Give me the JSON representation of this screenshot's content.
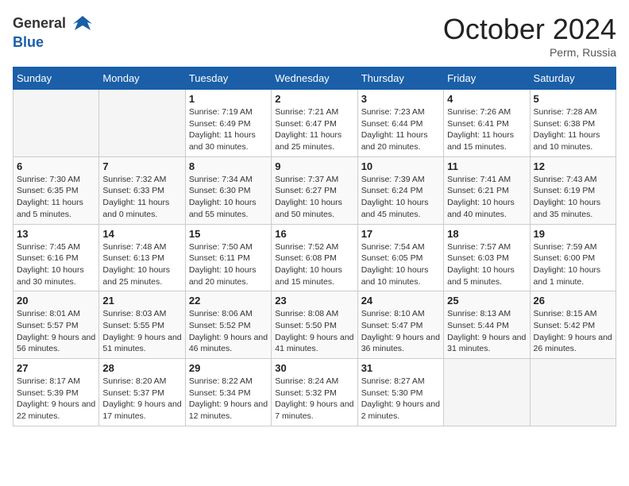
{
  "header": {
    "logo_general": "General",
    "logo_blue": "Blue",
    "month_title": "October 2024",
    "location": "Perm, Russia"
  },
  "weekdays": [
    "Sunday",
    "Monday",
    "Tuesday",
    "Wednesday",
    "Thursday",
    "Friday",
    "Saturday"
  ],
  "weeks": [
    [
      {
        "day": "",
        "info": ""
      },
      {
        "day": "",
        "info": ""
      },
      {
        "day": "1",
        "info": "Sunrise: 7:19 AM\nSunset: 6:49 PM\nDaylight: 11 hours and 30 minutes."
      },
      {
        "day": "2",
        "info": "Sunrise: 7:21 AM\nSunset: 6:47 PM\nDaylight: 11 hours and 25 minutes."
      },
      {
        "day": "3",
        "info": "Sunrise: 7:23 AM\nSunset: 6:44 PM\nDaylight: 11 hours and 20 minutes."
      },
      {
        "day": "4",
        "info": "Sunrise: 7:26 AM\nSunset: 6:41 PM\nDaylight: 11 hours and 15 minutes."
      },
      {
        "day": "5",
        "info": "Sunrise: 7:28 AM\nSunset: 6:38 PM\nDaylight: 11 hours and 10 minutes."
      }
    ],
    [
      {
        "day": "6",
        "info": "Sunrise: 7:30 AM\nSunset: 6:35 PM\nDaylight: 11 hours and 5 minutes."
      },
      {
        "day": "7",
        "info": "Sunrise: 7:32 AM\nSunset: 6:33 PM\nDaylight: 11 hours and 0 minutes."
      },
      {
        "day": "8",
        "info": "Sunrise: 7:34 AM\nSunset: 6:30 PM\nDaylight: 10 hours and 55 minutes."
      },
      {
        "day": "9",
        "info": "Sunrise: 7:37 AM\nSunset: 6:27 PM\nDaylight: 10 hours and 50 minutes."
      },
      {
        "day": "10",
        "info": "Sunrise: 7:39 AM\nSunset: 6:24 PM\nDaylight: 10 hours and 45 minutes."
      },
      {
        "day": "11",
        "info": "Sunrise: 7:41 AM\nSunset: 6:21 PM\nDaylight: 10 hours and 40 minutes."
      },
      {
        "day": "12",
        "info": "Sunrise: 7:43 AM\nSunset: 6:19 PM\nDaylight: 10 hours and 35 minutes."
      }
    ],
    [
      {
        "day": "13",
        "info": "Sunrise: 7:45 AM\nSunset: 6:16 PM\nDaylight: 10 hours and 30 minutes."
      },
      {
        "day": "14",
        "info": "Sunrise: 7:48 AM\nSunset: 6:13 PM\nDaylight: 10 hours and 25 minutes."
      },
      {
        "day": "15",
        "info": "Sunrise: 7:50 AM\nSunset: 6:11 PM\nDaylight: 10 hours and 20 minutes."
      },
      {
        "day": "16",
        "info": "Sunrise: 7:52 AM\nSunset: 6:08 PM\nDaylight: 10 hours and 15 minutes."
      },
      {
        "day": "17",
        "info": "Sunrise: 7:54 AM\nSunset: 6:05 PM\nDaylight: 10 hours and 10 minutes."
      },
      {
        "day": "18",
        "info": "Sunrise: 7:57 AM\nSunset: 6:03 PM\nDaylight: 10 hours and 5 minutes."
      },
      {
        "day": "19",
        "info": "Sunrise: 7:59 AM\nSunset: 6:00 PM\nDaylight: 10 hours and 1 minute."
      }
    ],
    [
      {
        "day": "20",
        "info": "Sunrise: 8:01 AM\nSunset: 5:57 PM\nDaylight: 9 hours and 56 minutes."
      },
      {
        "day": "21",
        "info": "Sunrise: 8:03 AM\nSunset: 5:55 PM\nDaylight: 9 hours and 51 minutes."
      },
      {
        "day": "22",
        "info": "Sunrise: 8:06 AM\nSunset: 5:52 PM\nDaylight: 9 hours and 46 minutes."
      },
      {
        "day": "23",
        "info": "Sunrise: 8:08 AM\nSunset: 5:50 PM\nDaylight: 9 hours and 41 minutes."
      },
      {
        "day": "24",
        "info": "Sunrise: 8:10 AM\nSunset: 5:47 PM\nDaylight: 9 hours and 36 minutes."
      },
      {
        "day": "25",
        "info": "Sunrise: 8:13 AM\nSunset: 5:44 PM\nDaylight: 9 hours and 31 minutes."
      },
      {
        "day": "26",
        "info": "Sunrise: 8:15 AM\nSunset: 5:42 PM\nDaylight: 9 hours and 26 minutes."
      }
    ],
    [
      {
        "day": "27",
        "info": "Sunrise: 8:17 AM\nSunset: 5:39 PM\nDaylight: 9 hours and 22 minutes."
      },
      {
        "day": "28",
        "info": "Sunrise: 8:20 AM\nSunset: 5:37 PM\nDaylight: 9 hours and 17 minutes."
      },
      {
        "day": "29",
        "info": "Sunrise: 8:22 AM\nSunset: 5:34 PM\nDaylight: 9 hours and 12 minutes."
      },
      {
        "day": "30",
        "info": "Sunrise: 8:24 AM\nSunset: 5:32 PM\nDaylight: 9 hours and 7 minutes."
      },
      {
        "day": "31",
        "info": "Sunrise: 8:27 AM\nSunset: 5:30 PM\nDaylight: 9 hours and 2 minutes."
      },
      {
        "day": "",
        "info": ""
      },
      {
        "day": "",
        "info": ""
      }
    ]
  ]
}
